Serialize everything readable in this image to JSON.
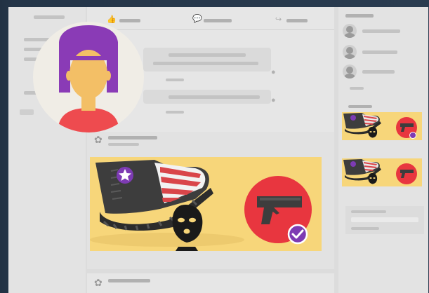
{
  "colors": {
    "background": "#dcdcdc",
    "feed_card": "#e8e8e8",
    "ad_yellow": "#f7d67a",
    "badge_purple": "#7d3bb3",
    "gun_circle": "#e8363f",
    "avatar_hair": "#8a3bb6",
    "avatar_skin": "#f3bf66",
    "avatar_shirt": "#ee4b4f",
    "flag_red": "#d9454a"
  },
  "icons": {
    "like": "thumbs-up-icon",
    "comment": "speech-bubble-icon",
    "share": "share-arrow-icon",
    "send": "send-icon",
    "check": "checkmark-icon",
    "star": "star-icon",
    "gun": "handgun-icon",
    "mask": "balaclava-mask-icon",
    "boot": "boot-icon"
  }
}
